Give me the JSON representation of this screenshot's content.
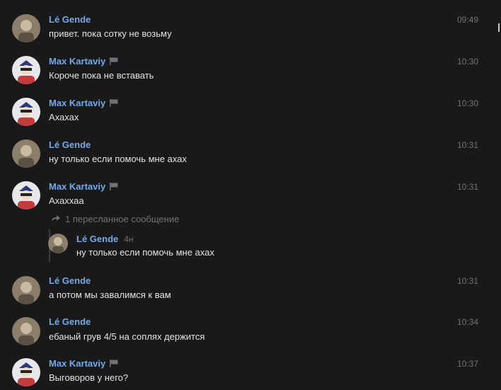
{
  "messages": [
    {
      "author": "Lé Gende",
      "avatar": "lg",
      "text": "привет. пока сотку не возьму",
      "time": "09:49",
      "flag": false
    },
    {
      "author": "Max Kartaviy",
      "avatar": "mk",
      "text": "Короче пока не вставать",
      "time": "10:30",
      "flag": true
    },
    {
      "author": "Max Kartaviy",
      "avatar": "mk",
      "text": "Ахахах",
      "time": "10:30",
      "flag": true
    },
    {
      "author": "Lé Gende",
      "avatar": "lg",
      "text": "ну только если помочь мне ахах",
      "time": "10:31",
      "flag": false
    },
    {
      "author": "Max Kartaviy",
      "avatar": "mk",
      "text": "Ахаххаа",
      "time": "10:31",
      "flag": true
    },
    {
      "author": "Lé Gende",
      "avatar": "lg",
      "text": "а потом мы завалимся к вам",
      "time": "10:31",
      "flag": false
    },
    {
      "author": "Lé Gende",
      "avatar": "lg",
      "text": "ебаный грув 4/5 на соплях держится",
      "time": "10:34",
      "flag": false
    },
    {
      "author": "Max Kartaviy",
      "avatar": "mk",
      "text": "Выговоров у него?",
      "time": "10:37",
      "flag": true
    }
  ],
  "forwarded": {
    "label": "1 пересланное сообщение",
    "author": "Lé Gende",
    "time": "4н",
    "text": "ну только если помочь мне ахах"
  },
  "colors": {
    "background": "#191919",
    "name": "#71aaeb",
    "text": "#e1e3e6",
    "muted": "#6f7276"
  },
  "icons": {
    "flag": "flag-icon",
    "forward": "forward-arrow-icon"
  }
}
